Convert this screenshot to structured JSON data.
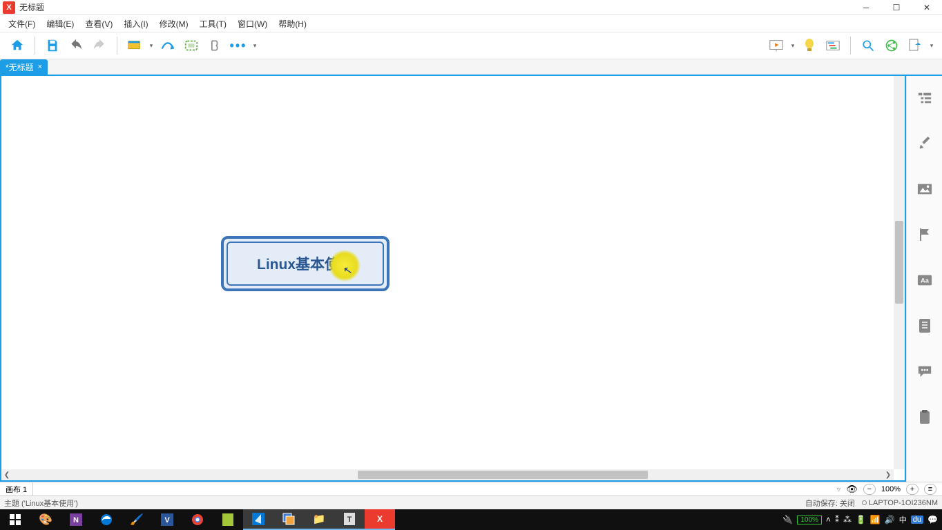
{
  "window": {
    "title": "无标题"
  },
  "menu": {
    "file": "文件(F)",
    "edit": "编辑(E)",
    "view": "查看(V)",
    "insert": "插入(I)",
    "modify": "修改(M)",
    "tools": "工具(T)",
    "window": "窗口(W)",
    "help": "帮助(H)"
  },
  "tab": {
    "label": "*无标题",
    "close": "×"
  },
  "node": {
    "text": "Linux基本使用"
  },
  "sheet": {
    "name": "画布 1"
  },
  "zoom": {
    "value": "100%"
  },
  "status": {
    "selection": "主题 ('Linux基本使用')",
    "autosave": "自动保存: 关闭",
    "host": "LAPTOP-1OI236NM"
  },
  "tray": {
    "battery": "100%",
    "ime": "中",
    "du": "du"
  }
}
